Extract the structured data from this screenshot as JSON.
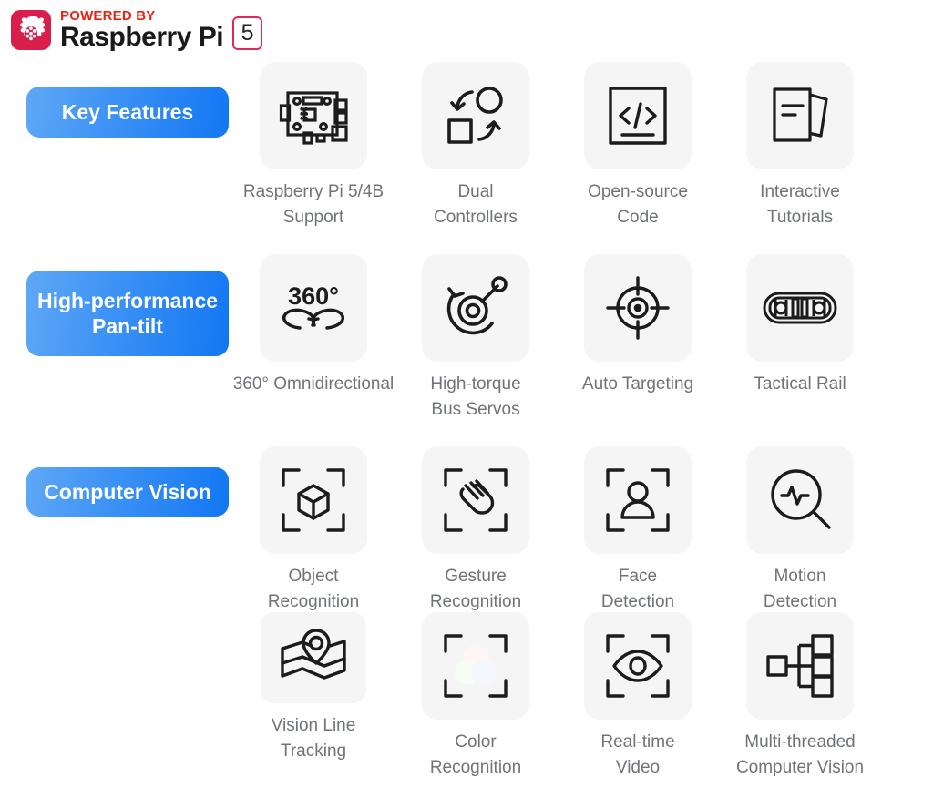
{
  "header": {
    "logo_icon": "raspberry-pi-logo-icon",
    "powered_by": "POWERED BY",
    "product_name": "Raspberry Pi",
    "model_number": "5",
    "brand_color": "#d81e4a",
    "powered_by_color": "#ee2211"
  },
  "badges": [
    {
      "label": "Key Features",
      "gradient_from": "#5fa8f5",
      "gradient_to": "#1277f3"
    },
    {
      "label": "High-performance\nPan-tilt",
      "gradient_from": "#5fa8f5",
      "gradient_to": "#1277f3"
    },
    {
      "label": "Computer Vision",
      "gradient_from": "#5fa8f5",
      "gradient_to": "#1277f3"
    }
  ],
  "tile_bg": "#f5f5f5",
  "caption_color": "#70737a",
  "features": [
    {
      "icon": "circuit-board-icon",
      "caption": "Raspberry Pi 5/4B\nSupport"
    },
    {
      "icon": "dual-controllers-icon",
      "caption": "Dual\nControllers"
    },
    {
      "icon": "code-brackets-icon",
      "caption": "Open-source\nCode"
    },
    {
      "icon": "documents-icon",
      "caption": "Interactive\nTutorials"
    },
    {
      "icon": "360-rotation-icon",
      "caption": "360° Omnidirectional"
    },
    {
      "icon": "servo-torque-icon",
      "caption": "High-torque\nBus Servos"
    },
    {
      "icon": "crosshair-target-icon",
      "caption": "Auto Targeting"
    },
    {
      "icon": "tactical-rail-icon",
      "caption": "Tactical Rail"
    },
    {
      "icon": "cube-scan-icon",
      "caption": "Object\nRecognition"
    },
    {
      "icon": "hand-gesture-scan-icon",
      "caption": "Gesture\nRecognition"
    },
    {
      "icon": "person-scan-icon",
      "caption": "Face\nDetection"
    },
    {
      "icon": "pulse-magnifier-icon",
      "caption": "Motion\nDetection"
    },
    {
      "icon": "map-pin-icon",
      "caption": "Vision Line\nTracking"
    },
    {
      "icon": "rgb-circles-scan-icon",
      "caption": "Color\nRecognition"
    },
    {
      "icon": "eye-scan-icon",
      "caption": "Real-time\nVideo"
    },
    {
      "icon": "node-tree-icon",
      "caption": "Multi-threaded\nComputer Vision"
    }
  ],
  "rgb_colors": {
    "red": "#ff0000",
    "green": "#00d400",
    "blue": "#0033ff"
  }
}
